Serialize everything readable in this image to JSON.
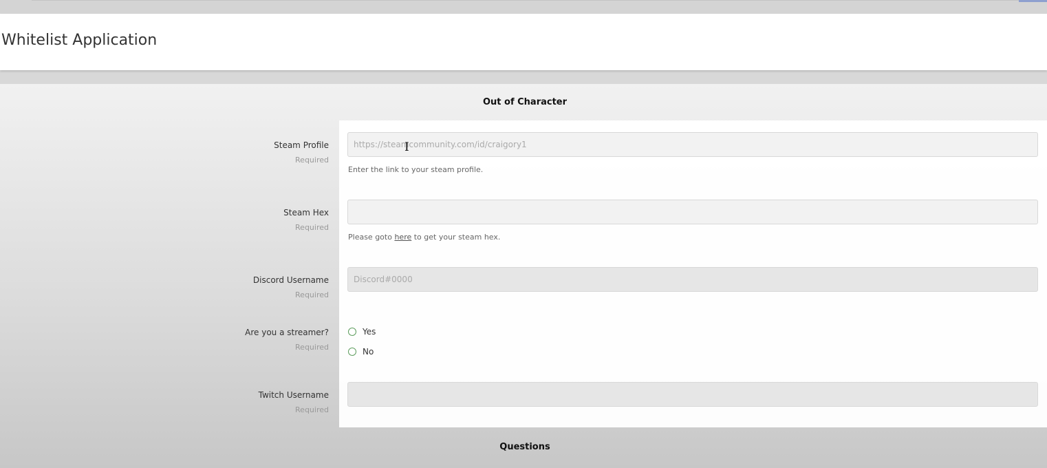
{
  "page": {
    "title": "Whitelist Application"
  },
  "sections": {
    "ooc_title": "Out of Character",
    "questions_title": "Questions"
  },
  "fields": {
    "steam_profile": {
      "label": "Steam Profile",
      "required": "Required",
      "placeholder": "https://steamcommunity.com/id/craigory1",
      "help": "Enter the link to your steam profile."
    },
    "steam_hex": {
      "label": "Steam Hex",
      "required": "Required",
      "placeholder": "",
      "help_prefix": "Please goto ",
      "help_link": "here",
      "help_suffix": " to get your steam hex."
    },
    "discord_username": {
      "label": "Discord Username",
      "required": "Required",
      "placeholder": "Discord#0000"
    },
    "streamer": {
      "label": "Are you a streamer?",
      "required": "Required",
      "options": [
        "Yes",
        "No"
      ]
    },
    "twitch_username": {
      "label": "Twitch Username",
      "required": "Required",
      "placeholder": ""
    }
  },
  "colors": {
    "radio_border": "#5c9c5c",
    "header_bg": "#ffffff",
    "field_bg": "#f2f2f2"
  },
  "icons": {
    "cursor": "text-cursor-icon"
  }
}
